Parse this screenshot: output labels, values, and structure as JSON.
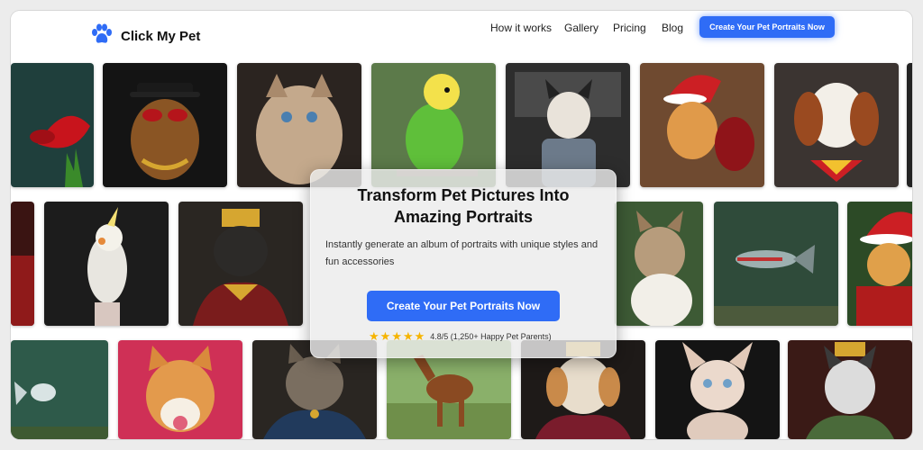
{
  "brand": {
    "name": "Click My Pet",
    "icon": "paw-icon",
    "color": "#2f6cf6"
  },
  "nav": {
    "links": [
      "How it works",
      "Gallery",
      "Pricing",
      "Blog"
    ],
    "cta": "Create Your Pet Portraits Now"
  },
  "hero": {
    "title": "Transform Pet Pictures Into Amazing Portraits",
    "subtitle": "Instantly generate an album of portraits with unique styles and fun accessories",
    "cta": "Create Your Pet Portraits Now",
    "rating": {
      "value": 4.8,
      "max": 5,
      "stars": 5,
      "text": "4.8/5 (1,250+ Happy Pet Parents)"
    }
  },
  "gallery": {
    "rows": [
      [
        "betta-fish-tile",
        "dog-sunglasses-tile",
        "fluffy-cat-tile",
        "budgie-tile",
        "french-bulldog-car-tile",
        "santa-cat-tile",
        "superman-spaniel-tile",
        "edge-tile"
      ],
      [
        "red-costume-tile",
        "cockatiel-tile",
        "royal-bulldog-tile",
        "hidden-tile",
        "tabby-cat-tile",
        "aquarium-fish-tile",
        "santa-dog-tile"
      ],
      [
        "aquarium-tile",
        "shiba-dog-tile",
        "royal-cat-tile",
        "horse-tile",
        "royal-dog-tile",
        "sphynx-cat-tile",
        "husky-king-tile"
      ]
    ]
  },
  "colors": {
    "accent": "#2f6cf6",
    "star": "#f6b400"
  }
}
